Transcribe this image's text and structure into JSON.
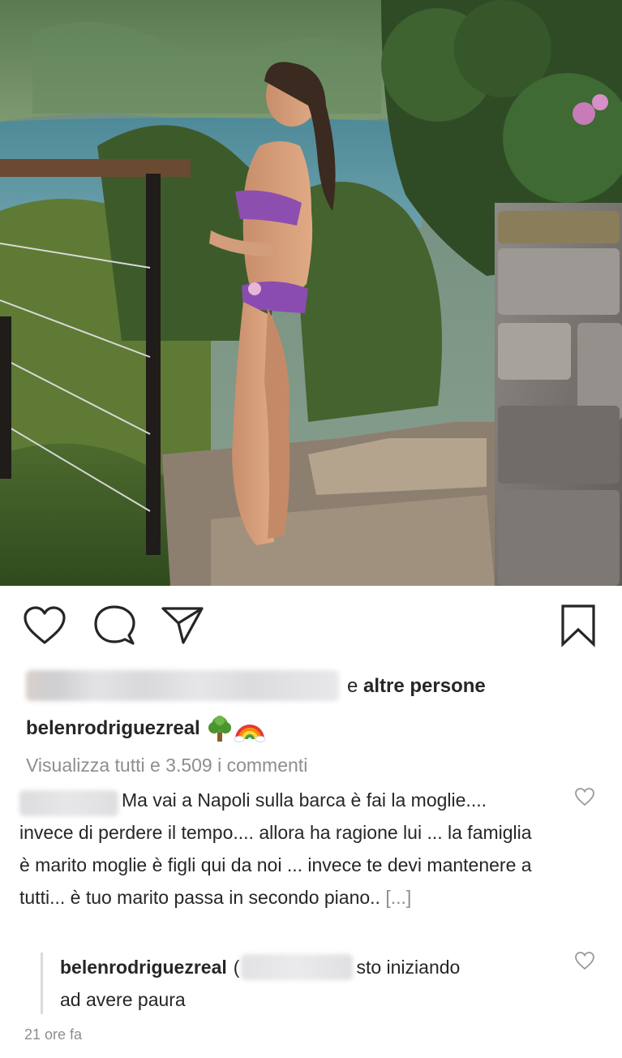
{
  "post": {
    "photo": {
      "description_icon": "photo-image"
    },
    "actions": {
      "like_icon": "heart-icon",
      "comment_icon": "comment-icon",
      "share_icon": "paper-plane-icon",
      "save_icon": "bookmark-icon"
    },
    "likes": {
      "prefix": "e",
      "suffix": "altre persone"
    },
    "caption": {
      "username": "belenrodriguezreal",
      "emojis": [
        "tree-emoji",
        "rainbow-emoji"
      ]
    },
    "view_all_comments": "Visualizza tutti e 3.509 i commenti",
    "comments": [
      {
        "text": "Ma vai a Napoli sulla barca è fai la moglie.... invece di perdere il tempo.... allora ha ragione lui ... la famiglia è marito moglie è figli qui da noi ... invece te devi mantenere a tutti... è tuo marito passa in secondo piano..",
        "more": "[...]"
      }
    ],
    "reply": {
      "username": "belenrodriguezreal",
      "paren": "(",
      "text_line1": "sto iniziando",
      "text_line2": "ad avere paura"
    },
    "timestamp": "21 ore fa",
    "colors": {
      "text": "#262626",
      "secondary": "#8e8e8e",
      "background": "#ffffff"
    }
  }
}
